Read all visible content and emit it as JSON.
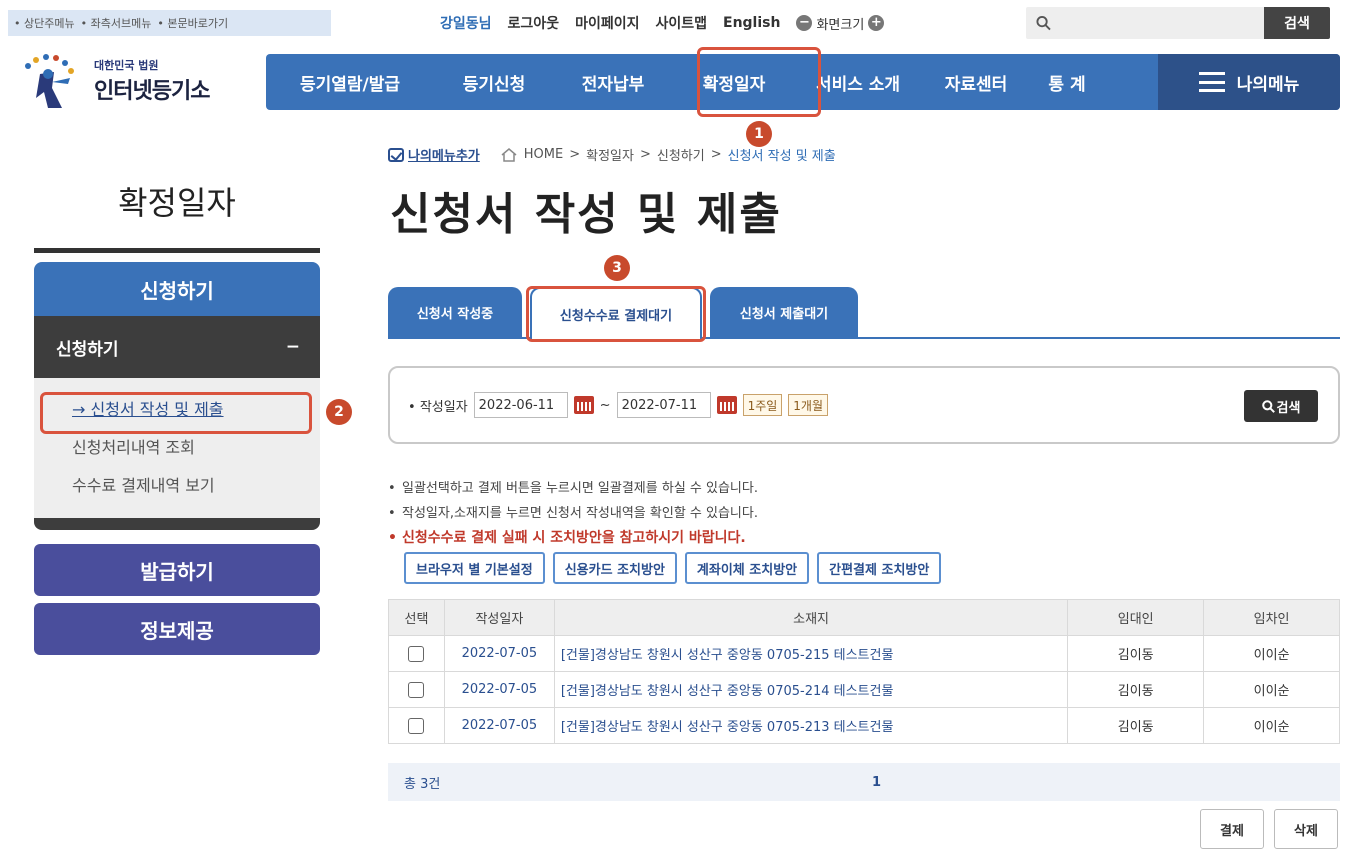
{
  "skip_links": [
    "상단주메뉴",
    "좌측서브메뉴",
    "본문바로가기"
  ],
  "util": {
    "user": "강일동님",
    "logout": "로그아웃",
    "mypage": "마이페이지",
    "sitemap": "사이트맵",
    "english": "English",
    "screen_size": "화면크기"
  },
  "search": {
    "placeholder": "",
    "button": "검색"
  },
  "logo": {
    "small": "대한민국 법원",
    "big": "인터넷등기소"
  },
  "gnb": {
    "items": [
      "등기열람/발급",
      "등기신청",
      "전자납부",
      "확정일자",
      "서비스 소개",
      "자료센터",
      "통 계"
    ],
    "mymenu": "나의메뉴"
  },
  "steps": [
    "1",
    "2",
    "3"
  ],
  "breadcrumb": {
    "add": "나의메뉴추가",
    "home": "HOME",
    "sep": ">",
    "level1": "확정일자",
    "level2": "신청하기",
    "current": "신청서 작성 및 제출"
  },
  "page_title": "신청서 작성 및 제출",
  "sidebar": {
    "title": "확정일자",
    "section": "신청하기",
    "sub": "신청하기",
    "sub_toggle": "−",
    "links": [
      "신청서 작성 및 제출",
      "신청처리내역 조회",
      "수수료 결제내역 보기"
    ],
    "buttons": [
      "발급하기",
      "정보제공"
    ]
  },
  "tabs": [
    "신청서 작성중",
    "신청수수료 결제대기",
    "신청서 제출대기"
  ],
  "date_search": {
    "label": "작성일자",
    "from": "2022-06-11",
    "to": "2022-07-11",
    "tilde": "~",
    "week": "1주일",
    "month": "1개월",
    "button": "검색"
  },
  "notes": [
    "일괄선택하고 결제 버튼을 누르시면 일괄결제를 하실 수 있습니다.",
    "작성일자,소재지를 누르면 신청서 작성내역을 확인할 수 있습니다.",
    "신청수수료 결제 실패 시 조치방안을 참고하시기 바랍니다."
  ],
  "guide_buttons": [
    "브라우저 별 기본설정",
    "신용카드 조치방안",
    "계좌이체 조치방안",
    "간편결제 조치방안"
  ],
  "table": {
    "headers": [
      "선택",
      "작성일자",
      "소재지",
      "임대인",
      "임차인"
    ],
    "rows": [
      {
        "date": "2022-07-05",
        "address": "[건물]경상남도 창원시 성산구 중앙동 0705-215 테스트건물",
        "lessor": "김이동",
        "lessee": "이이순"
      },
      {
        "date": "2022-07-05",
        "address": "[건물]경상남도 창원시 성산구 중앙동 0705-214 테스트건물",
        "lessor": "김이동",
        "lessee": "이이순"
      },
      {
        "date": "2022-07-05",
        "address": "[건물]경상남도 창원시 성산구 중앙동 0705-213 테스트건물",
        "lessor": "김이동",
        "lessee": "이이순"
      }
    ]
  },
  "pager": {
    "total": "총 3건",
    "page": "1"
  },
  "actions": {
    "pay": "결제",
    "delete": "삭제"
  },
  "colors": {
    "primary": "#3a72b8",
    "dark_nav": "#2d5189",
    "annotation": "#d9533d",
    "side_button": "#4a4e9c",
    "warning": "#c0392b"
  }
}
